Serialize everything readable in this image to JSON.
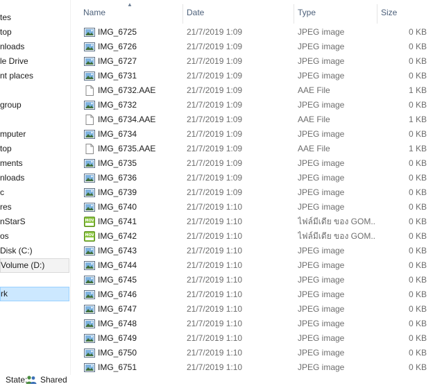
{
  "nav": {
    "items": [
      {
        "label": "tes"
      },
      {
        "label": "top"
      },
      {
        "label": "nloads"
      },
      {
        "label": "le Drive"
      },
      {
        "label": "nt places"
      },
      {
        "label": ""
      },
      {
        "label": "group"
      },
      {
        "label": ""
      },
      {
        "label": "mputer"
      },
      {
        "label": "top"
      },
      {
        "label": "ments"
      },
      {
        "label": "nloads"
      },
      {
        "label": "c"
      },
      {
        "label": "res"
      },
      {
        "label": "nStarS"
      },
      {
        "label": "os"
      },
      {
        "label": " Disk (C:)"
      },
      {
        "label": "Volume (D:)"
      },
      {
        "label": ""
      },
      {
        "label": "rk"
      }
    ]
  },
  "columns": {
    "name": "Name",
    "date": "Date",
    "type": "Type",
    "size": "Size"
  },
  "files": [
    {
      "name": "IMG_6725",
      "date": "21/7/2019 1:09",
      "type": "JPEG image",
      "size": "0 KB",
      "icon": "jpeg-image-icon"
    },
    {
      "name": "IMG_6726",
      "date": "21/7/2019 1:09",
      "type": "JPEG image",
      "size": "0 KB",
      "icon": "jpeg-image-icon"
    },
    {
      "name": "IMG_6727",
      "date": "21/7/2019 1:09",
      "type": "JPEG image",
      "size": "0 KB",
      "icon": "jpeg-image-icon"
    },
    {
      "name": "IMG_6731",
      "date": "21/7/2019 1:09",
      "type": "JPEG image",
      "size": "0 KB",
      "icon": "jpeg-image-icon"
    },
    {
      "name": "IMG_6732.AAE",
      "date": "21/7/2019 1:09",
      "type": "AAE File",
      "size": "1 KB",
      "icon": "blank-file-icon"
    },
    {
      "name": "IMG_6732",
      "date": "21/7/2019 1:09",
      "type": "JPEG image",
      "size": "0 KB",
      "icon": "jpeg-image-icon"
    },
    {
      "name": "IMG_6734.AAE",
      "date": "21/7/2019 1:09",
      "type": "AAE File",
      "size": "1 KB",
      "icon": "blank-file-icon"
    },
    {
      "name": "IMG_6734",
      "date": "21/7/2019 1:09",
      "type": "JPEG image",
      "size": "0 KB",
      "icon": "jpeg-image-icon"
    },
    {
      "name": "IMG_6735.AAE",
      "date": "21/7/2019 1:09",
      "type": "AAE File",
      "size": "1 KB",
      "icon": "blank-file-icon"
    },
    {
      "name": "IMG_6735",
      "date": "21/7/2019 1:09",
      "type": "JPEG image",
      "size": "0 KB",
      "icon": "jpeg-image-icon"
    },
    {
      "name": "IMG_6736",
      "date": "21/7/2019 1:09",
      "type": "JPEG image",
      "size": "0 KB",
      "icon": "jpeg-image-icon"
    },
    {
      "name": "IMG_6739",
      "date": "21/7/2019 1:09",
      "type": "JPEG image",
      "size": "0 KB",
      "icon": "jpeg-image-icon"
    },
    {
      "name": "IMG_6740",
      "date": "21/7/2019 1:10",
      "type": "JPEG image",
      "size": "0 KB",
      "icon": "jpeg-image-icon"
    },
    {
      "name": "IMG_6741",
      "date": "21/7/2019 1:10",
      "type": "ไฟล์มีเดีย ของ GOM...",
      "size": "0 KB",
      "icon": "mov-video-icon"
    },
    {
      "name": "IMG_6742",
      "date": "21/7/2019 1:10",
      "type": "ไฟล์มีเดีย ของ GOM...",
      "size": "0 KB",
      "icon": "mov-video-icon"
    },
    {
      "name": "IMG_6743",
      "date": "21/7/2019 1:10",
      "type": "JPEG image",
      "size": "0 KB",
      "icon": "jpeg-image-icon"
    },
    {
      "name": "IMG_6744",
      "date": "21/7/2019 1:10",
      "type": "JPEG image",
      "size": "0 KB",
      "icon": "jpeg-image-icon"
    },
    {
      "name": "IMG_6745",
      "date": "21/7/2019 1:10",
      "type": "JPEG image",
      "size": "0 KB",
      "icon": "jpeg-image-icon"
    },
    {
      "name": "IMG_6746",
      "date": "21/7/2019 1:10",
      "type": "JPEG image",
      "size": "0 KB",
      "icon": "jpeg-image-icon"
    },
    {
      "name": "IMG_6747",
      "date": "21/7/2019 1:10",
      "type": "JPEG image",
      "size": "0 KB",
      "icon": "jpeg-image-icon"
    },
    {
      "name": "IMG_6748",
      "date": "21/7/2019 1:10",
      "type": "JPEG image",
      "size": "0 KB",
      "icon": "jpeg-image-icon"
    },
    {
      "name": "IMG_6749",
      "date": "21/7/2019 1:10",
      "type": "JPEG image",
      "size": "0 KB",
      "icon": "jpeg-image-icon"
    },
    {
      "name": "IMG_6750",
      "date": "21/7/2019 1:10",
      "type": "JPEG image",
      "size": "0 KB",
      "icon": "jpeg-image-icon"
    },
    {
      "name": "IMG_6751",
      "date": "21/7/2019 1:10",
      "type": "JPEG image",
      "size": "0 KB",
      "icon": "jpeg-image-icon"
    }
  ],
  "status": {
    "state_label": "State:",
    "shared_label": "Shared",
    "shared_icon": "shared-users-icon"
  },
  "icons": {
    "sort": "sort-ascending-icon"
  }
}
